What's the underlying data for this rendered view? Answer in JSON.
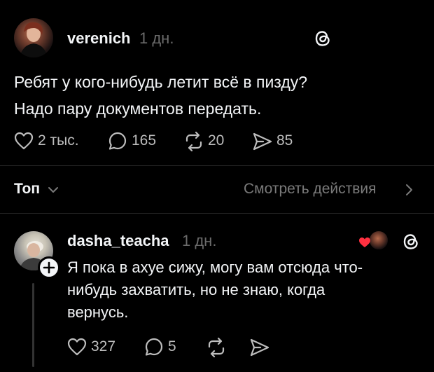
{
  "post": {
    "username": "verenich",
    "time": "1 дн.",
    "text_line1": "Ребят у кого-нибудь летит всё в пизду?",
    "text_line2": "Надо пару документов передать.",
    "likes": "2 тыс.",
    "comments": "165",
    "reposts": "20",
    "shares": "85"
  },
  "sort": {
    "label": "Топ",
    "activity_label": "Смотреть действия"
  },
  "reply": {
    "username": "dasha_teacha",
    "time": "1 дн.",
    "text_line1": "Я пока в ахуе сижу, могу вам отсюда что-",
    "text_line2": "нибудь захватить, но не знаю, когда",
    "text_line3": "вернусь.",
    "likes": "327",
    "comments": "5"
  },
  "colors": {
    "background": "#000000",
    "text": "#f3f5f7",
    "muted": "#7a7a7a",
    "like_heart": "#ff3040"
  }
}
